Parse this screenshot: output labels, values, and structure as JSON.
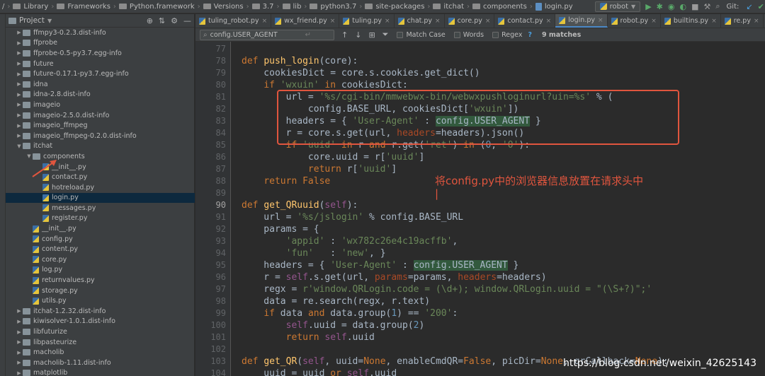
{
  "breadcrumb": [
    "/",
    "Library",
    "Frameworks",
    "Python.framework",
    "Versions",
    "3.7",
    "lib",
    "python3.7",
    "site-packages",
    "itchat",
    "components",
    "login.py"
  ],
  "run_config": "robot",
  "git_label": "Git:",
  "project": {
    "title": "Project",
    "tree": [
      {
        "label": "ffmpy3-0.2.3.dist-info",
        "indent": 2,
        "type": "folder",
        "arrow": "right"
      },
      {
        "label": "ffprobe",
        "indent": 2,
        "type": "folder",
        "arrow": "right"
      },
      {
        "label": "ffprobe-0.5-py3.7.egg-info",
        "indent": 2,
        "type": "folder",
        "arrow": "right"
      },
      {
        "label": "future",
        "indent": 2,
        "type": "folder",
        "arrow": "right"
      },
      {
        "label": "future-0.17.1-py3.7.egg-info",
        "indent": 2,
        "type": "folder",
        "arrow": "right"
      },
      {
        "label": "idna",
        "indent": 2,
        "type": "folder",
        "arrow": "right"
      },
      {
        "label": "idna-2.8.dist-info",
        "indent": 2,
        "type": "folder",
        "arrow": "right"
      },
      {
        "label": "imageio",
        "indent": 2,
        "type": "folder",
        "arrow": "right"
      },
      {
        "label": "imageio-2.5.0.dist-info",
        "indent": 2,
        "type": "folder",
        "arrow": "right"
      },
      {
        "label": "imageio_ffmpeg",
        "indent": 2,
        "type": "folder",
        "arrow": "right"
      },
      {
        "label": "imageio_ffmpeg-0.2.0.dist-info",
        "indent": 2,
        "type": "folder",
        "arrow": "right"
      },
      {
        "label": "itchat",
        "indent": 2,
        "type": "folder",
        "arrow": "down"
      },
      {
        "label": "components",
        "indent": 3,
        "type": "folder",
        "arrow": "down"
      },
      {
        "label": "__init__.py",
        "indent": 4,
        "type": "file"
      },
      {
        "label": "contact.py",
        "indent": 4,
        "type": "file"
      },
      {
        "label": "hotreload.py",
        "indent": 4,
        "type": "file"
      },
      {
        "label": "login.py",
        "indent": 4,
        "type": "file",
        "selected": true
      },
      {
        "label": "messages.py",
        "indent": 4,
        "type": "file"
      },
      {
        "label": "register.py",
        "indent": 4,
        "type": "file"
      },
      {
        "label": "__init__.py",
        "indent": 3,
        "type": "file"
      },
      {
        "label": "config.py",
        "indent": 3,
        "type": "file"
      },
      {
        "label": "content.py",
        "indent": 3,
        "type": "file"
      },
      {
        "label": "core.py",
        "indent": 3,
        "type": "file"
      },
      {
        "label": "log.py",
        "indent": 3,
        "type": "file"
      },
      {
        "label": "returnvalues.py",
        "indent": 3,
        "type": "file"
      },
      {
        "label": "storage.py",
        "indent": 3,
        "type": "file"
      },
      {
        "label": "utils.py",
        "indent": 3,
        "type": "file"
      },
      {
        "label": "itchat-1.2.32.dist-info",
        "indent": 2,
        "type": "folder",
        "arrow": "right"
      },
      {
        "label": "kiwisolver-1.0.1.dist-info",
        "indent": 2,
        "type": "folder",
        "arrow": "right"
      },
      {
        "label": "libfuturize",
        "indent": 2,
        "type": "folder",
        "arrow": "right"
      },
      {
        "label": "libpasteurize",
        "indent": 2,
        "type": "folder",
        "arrow": "right"
      },
      {
        "label": "macholib",
        "indent": 2,
        "type": "folder",
        "arrow": "right"
      },
      {
        "label": "macholib-1.11.dist-info",
        "indent": 2,
        "type": "folder",
        "arrow": "right"
      },
      {
        "label": "matplotlib",
        "indent": 2,
        "type": "folder",
        "arrow": "right"
      }
    ]
  },
  "tabs": [
    {
      "label": "tuling_robot.py"
    },
    {
      "label": "wx_friend.py"
    },
    {
      "label": "tuling.py"
    },
    {
      "label": "chat.py"
    },
    {
      "label": "core.py"
    },
    {
      "label": "contact.py"
    },
    {
      "label": "login.py",
      "active": true
    },
    {
      "label": "robot.py"
    },
    {
      "label": "builtins.py"
    },
    {
      "label": "re.py"
    }
  ],
  "search": {
    "value": "config.USER_AGENT",
    "match_case": "Match Case",
    "words": "Words",
    "regex": "Regex",
    "help": "?",
    "matches": "9 matches"
  },
  "annotation": {
    "line1": "将config.py中的浏览器信息放置在请求头中",
    "line2": "|"
  },
  "watermark": "https://blog.csdn.net/weixin_42625143",
  "editor": {
    "line_numbers": [
      "77",
      "78",
      "79",
      "80",
      "81",
      "82",
      "83",
      "84",
      "85",
      "86",
      "87",
      "88",
      "89",
      "90",
      "91",
      "92",
      "93",
      "94",
      "95",
      "96",
      "97",
      "98",
      "99",
      "100",
      "101",
      "102",
      "103",
      "104"
    ],
    "current_line": "90"
  },
  "colors": {
    "accent": "#4a88c7",
    "annotation": "#e0553e",
    "highlight": "#32593d"
  }
}
